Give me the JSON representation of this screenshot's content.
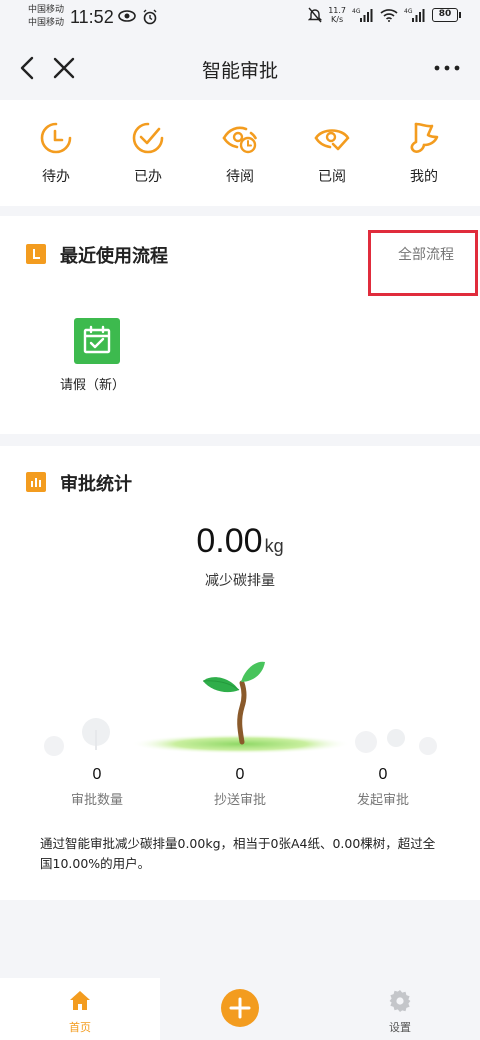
{
  "status_bar": {
    "carrier_1": "中国移动",
    "carrier_2": "中国移动",
    "time": "11:52",
    "speed_value": "11.7",
    "speed_unit": "K/s",
    "battery": "80"
  },
  "nav": {
    "title": "智能审批"
  },
  "quick_entries": [
    {
      "label": "待办",
      "icon": "clock-icon"
    },
    {
      "label": "已办",
      "icon": "check-circle-icon"
    },
    {
      "label": "待阅",
      "icon": "eye-clock-icon"
    },
    {
      "label": "已阅",
      "icon": "eye-check-icon"
    },
    {
      "label": "我的",
      "icon": "flag-icon"
    }
  ],
  "recent": {
    "title": "最近使用流程",
    "all_link": "全部流程",
    "apps": [
      {
        "label": "请假（新）",
        "icon": "calendar-check-icon"
      }
    ]
  },
  "stats": {
    "title": "审批统计",
    "carbon_value": "0.00",
    "carbon_unit": "kg",
    "carbon_label": "减少碳排量",
    "items": [
      {
        "value": "0",
        "label": "审批数量"
      },
      {
        "value": "0",
        "label": "抄送审批"
      },
      {
        "value": "0",
        "label": "发起审批"
      }
    ],
    "summary": "通过智能审批减少碳排量0.00kg，相当于0张A4纸、0.00棵树，超过全国10.00%的用户。"
  },
  "tabbar": {
    "home_label": "首页",
    "settings_label": "设置"
  },
  "colors": {
    "accent": "#f39c1f",
    "highlight": "#e02c3c",
    "app_green": "#3dba4e"
  }
}
